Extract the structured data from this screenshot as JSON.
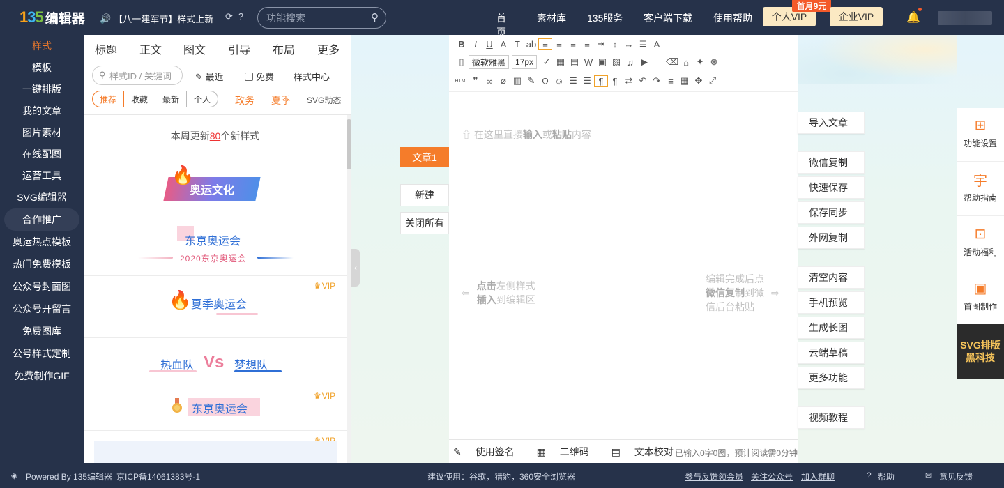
{
  "header": {
    "logo_num": "135",
    "logo_text": "编辑器",
    "announcement": "【八一建军节】样式上新",
    "search_placeholder": "功能搜索",
    "nav": [
      "首页",
      "素材库",
      "135服务",
      "客户端下载",
      "使用帮助"
    ],
    "vip_personal": "个人VIP",
    "vip_badge": "首月9元",
    "vip_enterprise": "企业VIP"
  },
  "sidebar": {
    "items": [
      "样式",
      "模板",
      "一键排版",
      "我的文章",
      "图片素材",
      "在线配图",
      "运营工具",
      "SVG编辑器",
      "合作推广",
      "奥运热点模板",
      "热门免费模板",
      "公众号封面图",
      "公众号开留言",
      "免费图库",
      "公号样式定制",
      "免费制作GIF"
    ]
  },
  "panel": {
    "tabs": [
      "标题",
      "正文",
      "图文",
      "引导",
      "布局",
      "更多"
    ],
    "search_placeholder": "样式ID / 关键词",
    "recent": "最近",
    "free": "免费",
    "center": "样式中心",
    "filters": [
      "推荐",
      "收藏",
      "最新",
      "个人"
    ],
    "tag1": "政务",
    "tag2": "夏季",
    "tag3": "SVG动态",
    "weekly_pre": "本周更新",
    "weekly_num": "80",
    "weekly_post": "个新样式",
    "s1": "奥运文化",
    "s2": "东京奥运会",
    "s2sub": "2020东京奥运会",
    "s3": "夏季奥运会",
    "vip": "VIP",
    "s4a": "热血队",
    "s4v": "Vs",
    "s4b": "梦想队",
    "s5": "东京奥运会"
  },
  "docs": {
    "tab": "文章1",
    "new": "新建",
    "close_all": "关闭所有"
  },
  "editor": {
    "font": "微软雅黑",
    "size": "17px",
    "ph_pre": "在这里直接",
    "ph_b1": "输入",
    "ph_mid": "或",
    "ph_b2": "粘贴",
    "ph_post": "内容",
    "hl_b1": "点击",
    "hl_t1": "左侧样式",
    "hl_b2": "插入",
    "hl_t2": "到编辑区",
    "hr_t1": "编辑完成后点",
    "hr_b": "微信复制",
    "hr_t2": "到微",
    "hr_t3": "信后台粘贴",
    "sign": "使用签名",
    "qr": "二维码",
    "proof": "文本校对",
    "count": "已输入0字0图，预计阅读需0分钟"
  },
  "actions": [
    "导入文章",
    "微信复制",
    "快速保存",
    "保存同步",
    "外网复制",
    "清空内容",
    "手机预览",
    "生成长图",
    "云端草稿",
    "更多功能",
    "视频教程"
  ],
  "rightbar": {
    "items": [
      "功能设置",
      "帮助指南",
      "活动福利",
      "首图制作"
    ],
    "promo1": "SVG排版",
    "promo2": "黑科技"
  },
  "footer": {
    "powered": "Powered By 135编辑器",
    "icp": "京ICP备14061383号-1",
    "suggest": "建议使用：谷歌，猎豹，360安全浏览器",
    "feedback_member": "参与反馈领会员",
    "follow": "关注公众号",
    "group": "加入群聊",
    "help": "帮助",
    "opinion": "意见反馈"
  },
  "colors": {
    "header_bg": "#26324a",
    "accent": "#f57c2a",
    "vip_bg": "#fbe9c3",
    "link_blue": "#2f6fd6"
  }
}
